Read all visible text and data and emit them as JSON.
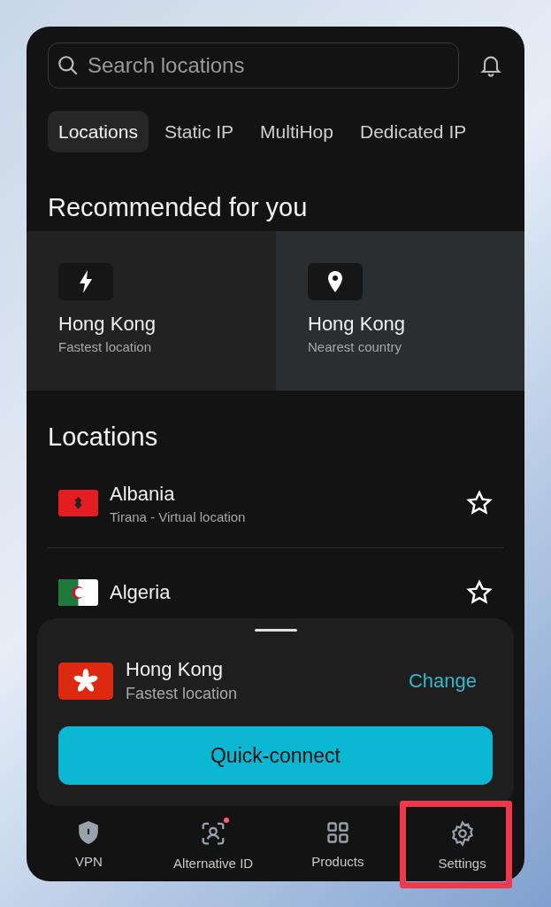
{
  "search": {
    "placeholder": "Search locations"
  },
  "tabs": [
    {
      "label": "Locations",
      "selected": true
    },
    {
      "label": "Static IP",
      "selected": false
    },
    {
      "label": "MultiHop",
      "selected": false
    },
    {
      "label": "Dedicated IP",
      "selected": false
    }
  ],
  "recommended": {
    "title": "Recommended for you",
    "cards": [
      {
        "kind": "fastest",
        "name": "Hong Kong",
        "subtitle": "Fastest location",
        "selected": false
      },
      {
        "kind": "nearest",
        "name": "Hong Kong",
        "subtitle": "Nearest country",
        "selected": true
      }
    ]
  },
  "locations": {
    "title": "Locations",
    "items": [
      {
        "kind": "albania",
        "name": "Albania",
        "subtitle": "Tirana - Virtual location",
        "favorite": false
      },
      {
        "kind": "algeria",
        "name": "Algeria",
        "favorite": false
      }
    ]
  },
  "connect_panel": {
    "kind": "hongkong",
    "name": "Hong Kong",
    "subtitle": "Fastest location",
    "change": "Change",
    "button": "Quick-connect"
  },
  "nav": [
    {
      "kind": "vpn",
      "label": "VPN",
      "selected": false,
      "badge": false,
      "highlighted": false
    },
    {
      "kind": "id",
      "label": "Alternative ID",
      "selected": false,
      "badge": true,
      "highlighted": false
    },
    {
      "kind": "products",
      "label": "Products",
      "selected": false,
      "badge": false,
      "highlighted": false
    },
    {
      "kind": "settings",
      "label": "Settings",
      "selected": false,
      "badge": false,
      "highlighted": true
    }
  ]
}
